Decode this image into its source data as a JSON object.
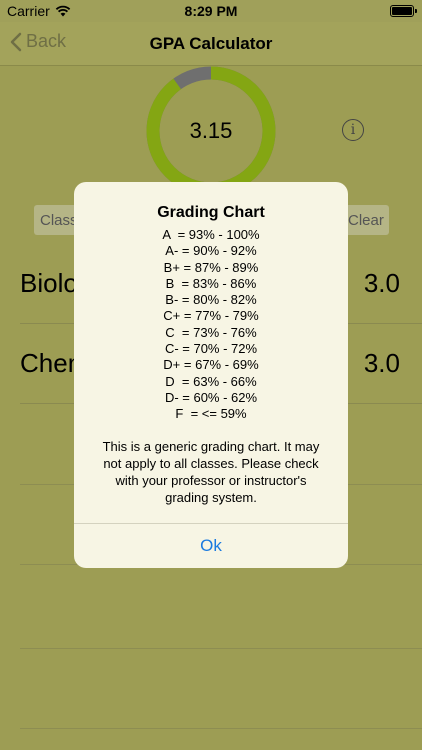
{
  "status": {
    "carrier": "Carrier",
    "time": "8:29 PM"
  },
  "nav": {
    "back_label": "Back",
    "title": "GPA Calculator"
  },
  "gauge": {
    "value": "3.15",
    "fraction": 0.9,
    "colors": {
      "fill": "#84a613",
      "track": "#6f6f6f"
    }
  },
  "controls": {
    "class_placeholder": "Class",
    "clear_label": "Clear"
  },
  "rows": [
    {
      "name": "Biology",
      "grade": "3.0"
    },
    {
      "name": "Chemistry",
      "grade": "3.0"
    }
  ],
  "dialog": {
    "title": "Grading Chart",
    "lines": [
      "A  = 93% - 100%",
      "A- = 90% - 92%",
      "B+ = 87% - 89%",
      "B  = 83% - 86%",
      "B- = 80% - 82%",
      "C+ = 77% - 79%",
      "C  = 73% - 76%",
      "C- = 70% - 72%",
      "D+ = 67% - 69%",
      "D  = 63% - 66%",
      "D- = 60% - 62%",
      "F  = <= 59%"
    ],
    "note": "This is a generic grading chart. It may not apply to all classes. Please check with your professor or instructor's grading system.",
    "ok_label": "Ok"
  }
}
